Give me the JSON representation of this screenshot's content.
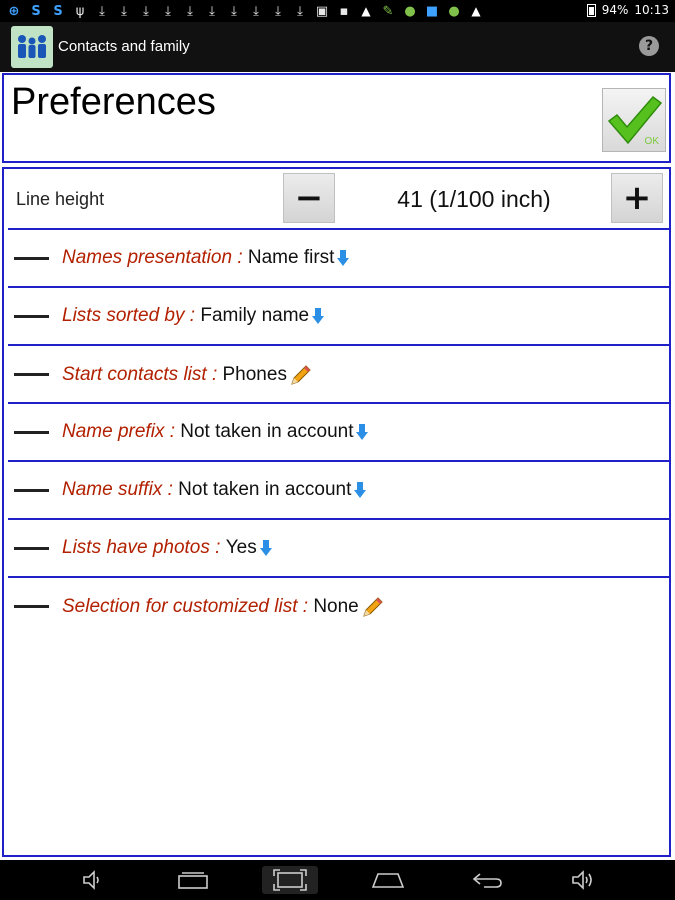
{
  "status_bar": {
    "battery": "94%",
    "time": "10:13",
    "icons": [
      "sync-icon",
      "sync-icon",
      "sync-icon",
      "usb-icon",
      "download-icon",
      "download-icon",
      "download-icon",
      "download-icon",
      "download-icon",
      "download-icon",
      "download-icon",
      "download-icon",
      "download-icon",
      "download-icon",
      "image-icon",
      "image-icon",
      "warning-icon",
      "broom-icon",
      "android-icon",
      "photo-icon",
      "android-icon",
      "warning-icon"
    ]
  },
  "action_bar": {
    "title": "Contacts and family",
    "app_icon": "family-icon",
    "help_icon": "help-icon"
  },
  "header": {
    "title": "Preferences",
    "ok_label": "OK"
  },
  "line_height": {
    "label": "Line height",
    "value": "41 (1/100 inch)",
    "minus_label": "−",
    "plus_label": "+"
  },
  "preferences": [
    {
      "label": "Names presentation : ",
      "value": "Name first",
      "icon": "dropdown-arrow-icon"
    },
    {
      "label": "Lists sorted by : ",
      "value": "Family name",
      "icon": "dropdown-arrow-icon"
    },
    {
      "label": "Start contacts list : ",
      "value": "Phones",
      "icon": "pencil-icon"
    },
    {
      "label": "Name prefix : ",
      "value": "Not taken in account",
      "icon": "dropdown-arrow-icon"
    },
    {
      "label": "Name suffix : ",
      "value": "Not taken in account",
      "icon": "dropdown-arrow-icon"
    },
    {
      "label": "Lists have photos : ",
      "value": "Yes",
      "icon": "dropdown-arrow-icon"
    },
    {
      "label": "Selection for customized list : ",
      "value": "None",
      "icon": "pencil-icon"
    }
  ],
  "nav_bar": {
    "icons": [
      "volume-down-icon",
      "recent-apps-icon",
      "screenshot-icon",
      "home-icon",
      "back-icon",
      "volume-up-icon"
    ]
  },
  "colors": {
    "accent_border": "#2020c8",
    "label_red": "#b22000",
    "ok_green": "#7cc93a"
  }
}
